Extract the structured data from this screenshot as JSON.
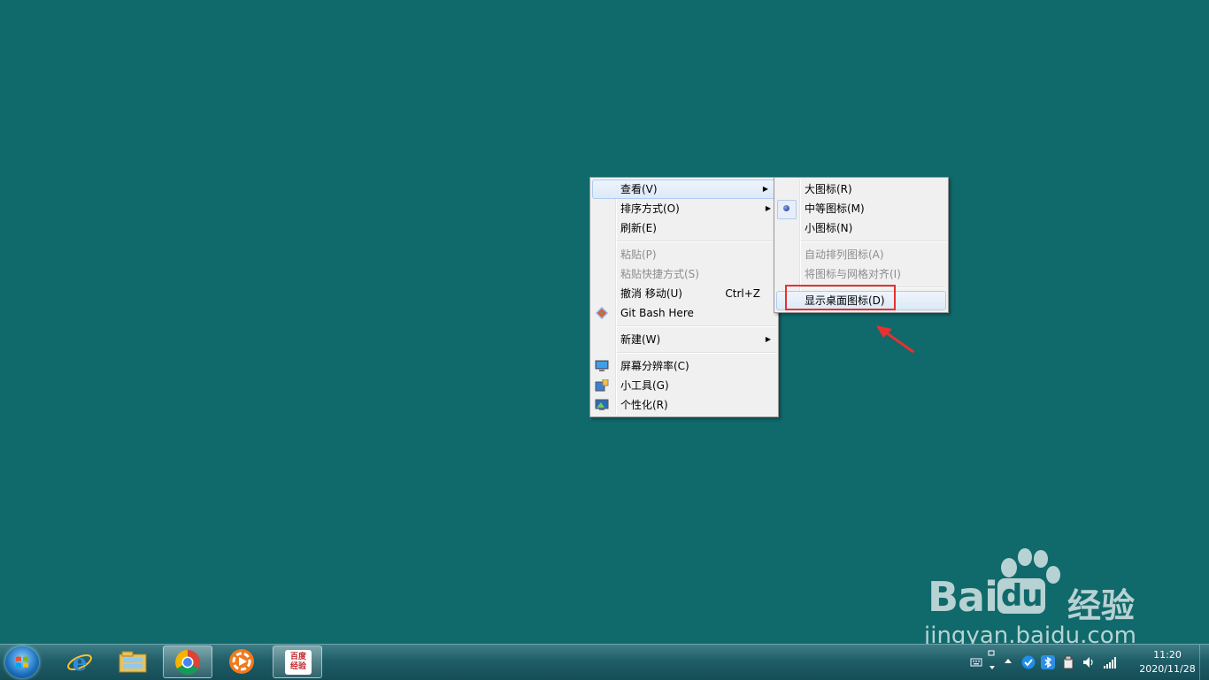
{
  "context_menu": {
    "items": [
      {
        "label": "查看(V)"
      },
      {
        "label": "排序方式(O)"
      },
      {
        "label": "刷新(E)"
      },
      {
        "label": "粘贴(P)"
      },
      {
        "label": "粘贴快捷方式(S)"
      },
      {
        "label": "撤消 移动(U)",
        "shortcut": "Ctrl+Z"
      },
      {
        "label": "Git Bash Here"
      },
      {
        "label": "新建(W)"
      },
      {
        "label": "屏幕分辨率(C)"
      },
      {
        "label": "小工具(G)"
      },
      {
        "label": "个性化(R)"
      }
    ]
  },
  "view_submenu": {
    "items": [
      {
        "label": "大图标(R)"
      },
      {
        "label": "中等图标(M)"
      },
      {
        "label": "小图标(N)"
      },
      {
        "label": "自动排列图标(A)"
      },
      {
        "label": "将图标与网格对齐(I)"
      },
      {
        "label": "显示桌面图标(D)"
      }
    ]
  },
  "watermark": {
    "brand": "Bai",
    "du": "du",
    "suffix": "经验",
    "url": "jingyan.baidu.com"
  },
  "taskbar": {
    "apps": [
      {
        "name": "internet-explorer"
      },
      {
        "name": "file-explorer"
      },
      {
        "name": "chrome"
      },
      {
        "name": "video-player"
      },
      {
        "name": "baidu-jingyan",
        "label": "百度经验"
      }
    ],
    "clock": {
      "time": "11:20",
      "date": "2020/11/28"
    }
  },
  "colors": {
    "desktop": "#10696b",
    "highlight_box": "#e8312f",
    "arrow": "#e8312f"
  }
}
